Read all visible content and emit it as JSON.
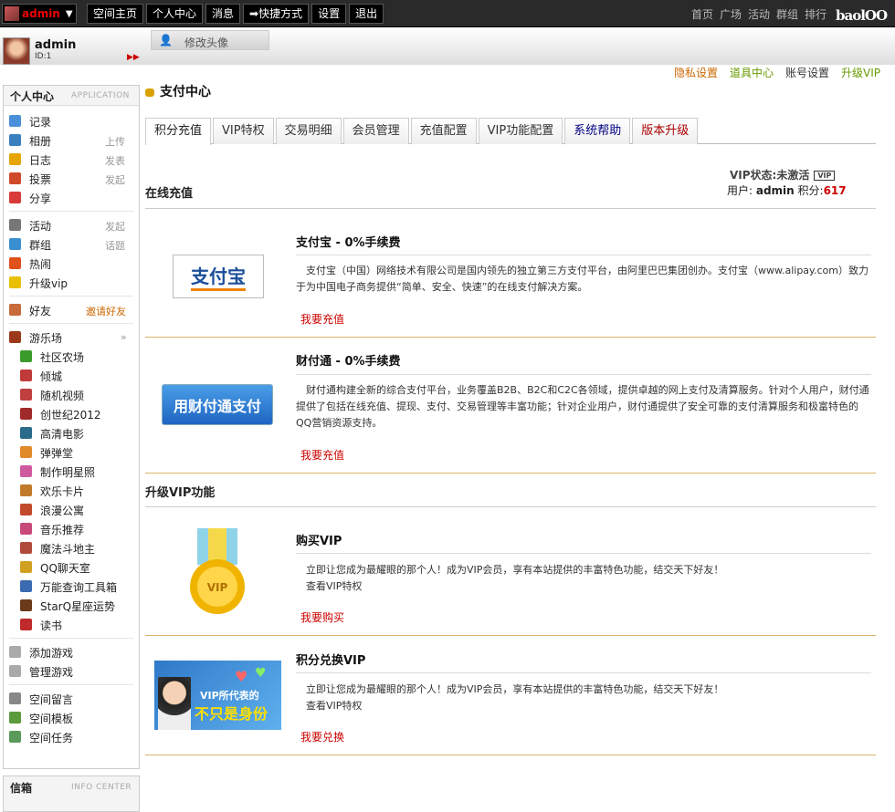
{
  "topbar": {
    "username": "admin",
    "nav": [
      "空间主页",
      "个人中心",
      "消息",
      "快捷方式",
      "设置",
      "退出"
    ],
    "right_nav": [
      "首页",
      "广场",
      "活动",
      "群组",
      "排行"
    ],
    "logo": "baolOO"
  },
  "avatar_tab": {
    "label": "修改头像"
  },
  "profile": {
    "name": "admin",
    "id": "ID:1"
  },
  "sidebar": {
    "header": "个人中心",
    "header_en": "APPLICATION",
    "items": [
      {
        "label": "记录",
        "right": "",
        "color": "#4a90d9"
      },
      {
        "label": "相册",
        "right": "上传",
        "color": "#3a7fc0"
      },
      {
        "label": "日志",
        "right": "发表",
        "color": "#e6a400"
      },
      {
        "label": "投票",
        "right": "发起",
        "color": "#d04a2a"
      },
      {
        "label": "分享",
        "right": "",
        "color": "#d83a3a"
      }
    ],
    "items2": [
      {
        "label": "活动",
        "right": "发起",
        "color": "#777"
      },
      {
        "label": "群组",
        "right": "话题",
        "color": "#3a8fd0"
      },
      {
        "label": "热闹",
        "right": "",
        "color": "#e0501a"
      },
      {
        "label": "升级vip",
        "right": "",
        "color": "#e8c000"
      }
    ],
    "friends": {
      "label": "好友",
      "right": "邀请好友",
      "color": "#c96a3a"
    },
    "games_header": {
      "label": "游乐场",
      "color": "#9a3a1a"
    },
    "games": [
      {
        "label": "社区农场",
        "color": "#3a9a2a"
      },
      {
        "label": "倾城",
        "color": "#c03a3a"
      },
      {
        "label": "随机视频",
        "color": "#c04040"
      },
      {
        "label": "创世纪2012",
        "color": "#a02a2a"
      },
      {
        "label": "高清电影",
        "color": "#2a6a8a"
      },
      {
        "label": "弹弹堂",
        "color": "#e08a2a"
      },
      {
        "label": "制作明星照",
        "color": "#d05aa0"
      },
      {
        "label": "欢乐卡片",
        "color": "#c07a2a"
      },
      {
        "label": "浪漫公寓",
        "color": "#c04a2a"
      },
      {
        "label": "音乐推荐",
        "color": "#c84a7a"
      },
      {
        "label": "魔法斗地主",
        "color": "#b04a3a"
      },
      {
        "label": "QQ聊天室",
        "color": "#d0a020"
      },
      {
        "label": "万能查询工具箱",
        "color": "#3a6ab0"
      },
      {
        "label": "StarQ星座运势",
        "color": "#6a3a1a"
      },
      {
        "label": "读书",
        "color": "#c02a2a"
      }
    ],
    "manage": [
      {
        "label": "添加游戏",
        "color": "#aaa"
      },
      {
        "label": "管理游戏",
        "color": "#aaa"
      }
    ],
    "space": [
      {
        "label": "空间留言",
        "color": "#888"
      },
      {
        "label": "空间模板",
        "color": "#5a9a3a"
      },
      {
        "label": "空间任务",
        "color": "#5a9a5a"
      }
    ],
    "info_header": "信箱",
    "info_header_en": "INFO CENTER"
  },
  "toplinks": [
    {
      "label": "隐私设置",
      "color": "#cc6600"
    },
    {
      "label": "道具中心",
      "color": "#669900"
    },
    {
      "label": "账号设置",
      "color": "#333333"
    },
    {
      "label": "升级VIP",
      "color": "#669900"
    }
  ],
  "page_title": "支付中心",
  "tabs": [
    {
      "label": "积分充值",
      "color": "#222222"
    },
    {
      "label": "VIP特权",
      "color": "#333333"
    },
    {
      "label": "交易明细",
      "color": "#333333"
    },
    {
      "label": "会员管理",
      "color": "#333333"
    },
    {
      "label": "充值配置",
      "color": "#333333"
    },
    {
      "label": "VIP功能配置",
      "color": "#333333"
    },
    {
      "label": "系统帮助",
      "color": "#000080"
    },
    {
      "label": "版本升级",
      "color": "#aa0000"
    }
  ],
  "vip_status": {
    "label": "VIP状态:未激活",
    "badge": "VIP"
  },
  "user_line": {
    "prefix": "用户: ",
    "user": "admin",
    "points_label": " 积分:",
    "points": "617"
  },
  "online_header": "在线充值",
  "alipay": {
    "logo_text": "支付宝",
    "title": "支付宝 - 0%手续费",
    "desc": "支付宝（中国）网络技术有限公司是国内领先的独立第三方支付平台，由阿里巴巴集团创办。支付宝（www.alipay.com）致力于为中国电子商务提供“简单、安全、快速”的在线支付解决方案。",
    "button": "我要充值"
  },
  "tenpay": {
    "logo_text": "用财付通支付",
    "title": "财付通 - 0%手续费",
    "desc": "财付通构建全新的综合支付平台，业务覆盖B2B、B2C和C2C各领域，提供卓越的网上支付及清算服务。针对个人用户，财付通提供了包括在线充值、提现、支付、交易管理等丰富功能；针对企业用户，财付通提供了安全可靠的支付清算服务和极富特色的QQ营销资源支持。",
    "button": "我要充值"
  },
  "vip_header": "升级VIP功能",
  "buy_vip": {
    "medal_text": "VIP",
    "title": "购买VIP",
    "desc1": "立即让您成为最耀眼的那个人！成为VIP会员，享有本站提供的丰富特色功能，结交天下好友！",
    "desc2": "查看VIP特权",
    "button": "我要购买"
  },
  "exchange_vip": {
    "img_text1": "VIP所代表的",
    "img_text2": "不只是身份",
    "title": "积分兑换VIP",
    "desc1": "立即让您成为最耀眼的那个人！成为VIP会员，享有本站提供的丰富特色功能，结交天下好友！",
    "desc2": "查看VIP特权",
    "button": "我要兑换"
  }
}
